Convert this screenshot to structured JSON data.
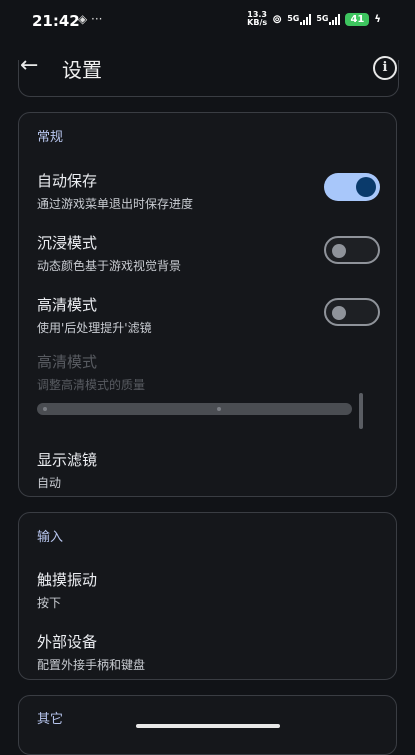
{
  "status": {
    "time": "21:42",
    "left_icons": "◈ ···",
    "net_speed": "13.3",
    "net_unit": "KB/s",
    "sig1": "5G",
    "sig2": "5G",
    "battery": "41"
  },
  "header": {
    "title": "设置",
    "back_icon": "←",
    "info_icon": "i"
  },
  "general": {
    "section_label": "常规",
    "autosave": {
      "title": "自动保存",
      "subtitle": "通过游戏菜单退出时保存进度",
      "enabled": true
    },
    "immersive": {
      "title": "沉浸模式",
      "subtitle": "动态颜色基于游戏视觉背景",
      "enabled": false
    },
    "hd_mode": {
      "title": "高清模式",
      "subtitle": "使用'后处理提升'滤镜",
      "enabled": false
    },
    "hd_quality": {
      "title": "高清模式",
      "subtitle": "调整高清模式的质量",
      "disabled": true
    },
    "filter": {
      "title": "显示滤镜",
      "value": "自动"
    }
  },
  "input": {
    "section_label": "输入",
    "haptics": {
      "title": "触摸振动",
      "value": "按下"
    },
    "external": {
      "title": "外部设备",
      "subtitle": "配置外接手柄和键盘"
    }
  },
  "other": {
    "section_label": "其它"
  },
  "colors": {
    "accent": "#a8c7fa",
    "background": "#111317",
    "battery": "#3ec55f"
  }
}
